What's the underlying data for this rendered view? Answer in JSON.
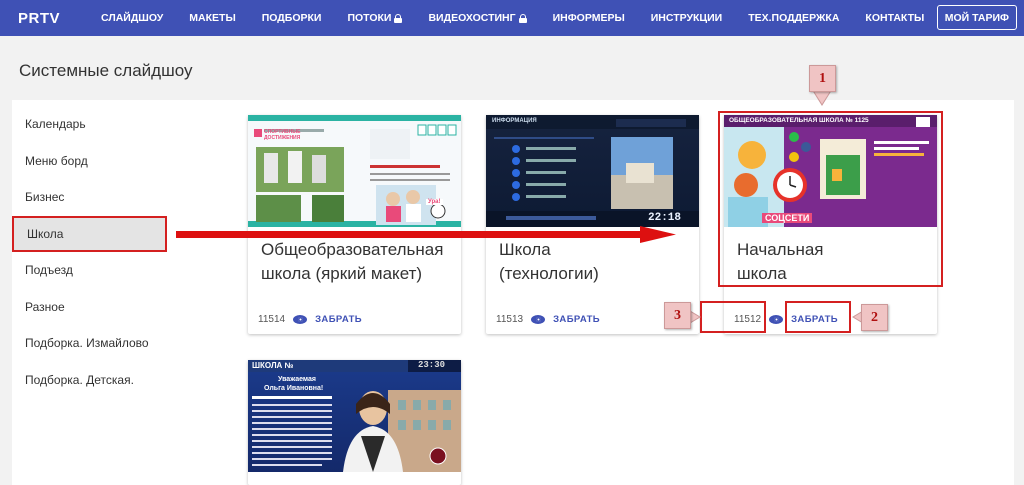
{
  "header": {
    "logo": "PRTV",
    "nav": [
      {
        "label": "СЛАЙДШОУ",
        "locked": false
      },
      {
        "label": "МАКЕТЫ",
        "locked": false
      },
      {
        "label": "ПОДБОРКИ",
        "locked": false
      },
      {
        "label": "ПОТОКИ",
        "locked": true
      },
      {
        "label": "ВИДЕОХОСТИНГ",
        "locked": true
      },
      {
        "label": "ИНФОРМЕРЫ",
        "locked": false
      },
      {
        "label": "ИНСТРУКЦИИ",
        "locked": false
      },
      {
        "label": "ТЕХ.ПОДДЕРЖКА",
        "locked": false
      },
      {
        "label": "КОНТАКТЫ",
        "locked": false
      }
    ],
    "tariff_button": "МОЙ ТАРИФ"
  },
  "page_title": "Системные слайдшоу",
  "sidebar": {
    "items": [
      {
        "label": "Календарь",
        "active": false
      },
      {
        "label": "Меню борд",
        "active": false
      },
      {
        "label": "Бизнес",
        "active": false
      },
      {
        "label": "Школа",
        "active": true
      },
      {
        "label": "Подъезд",
        "active": false
      },
      {
        "label": "Разное",
        "active": false
      },
      {
        "label": "Подборка. Измайлово",
        "active": false
      },
      {
        "label": "Подборка. Детская.",
        "active": false
      }
    ]
  },
  "cards": [
    {
      "title_line1": "Общеобразовательная",
      "title_line2": "школа (яркий макет)",
      "id": "11514",
      "action": "ЗАБРАТЬ"
    },
    {
      "title_line1": "Школа",
      "title_line2": "(технологии)",
      "id": "11513",
      "action": "ЗАБРАТЬ"
    },
    {
      "title_line1": "Начальная",
      "title_line2": "школа",
      "id": "11512",
      "action": "ЗАБРАТЬ"
    },
    {
      "title_line1": "",
      "title_line2": "",
      "id": "",
      "action": ""
    }
  ],
  "thumbnails": {
    "t1_heading": "СПОРТИВНЫЕ ДОСТИЖЕНИЯ",
    "t1_badge": "Ура!",
    "t2_heading": "ИНФОРМАЦИЯ",
    "t2_time": "22:18",
    "t3_heading": "ОБЩЕОБРАЗОВАТЕЛЬНАЯ ШКОЛА № 1125",
    "t3_sub": "СОЦСЕТИ",
    "t4_heading": "ШКОЛА №",
    "t4_time": "23:30",
    "t4_greeting_1": "Уважаемая",
    "t4_greeting_2": "Ольга Ивановна!"
  },
  "annotations": {
    "callout_1": "1",
    "callout_2": "2",
    "callout_3": "3"
  },
  "colors": {
    "brand": "#3f51b5",
    "annotation_red": "#d42020"
  }
}
